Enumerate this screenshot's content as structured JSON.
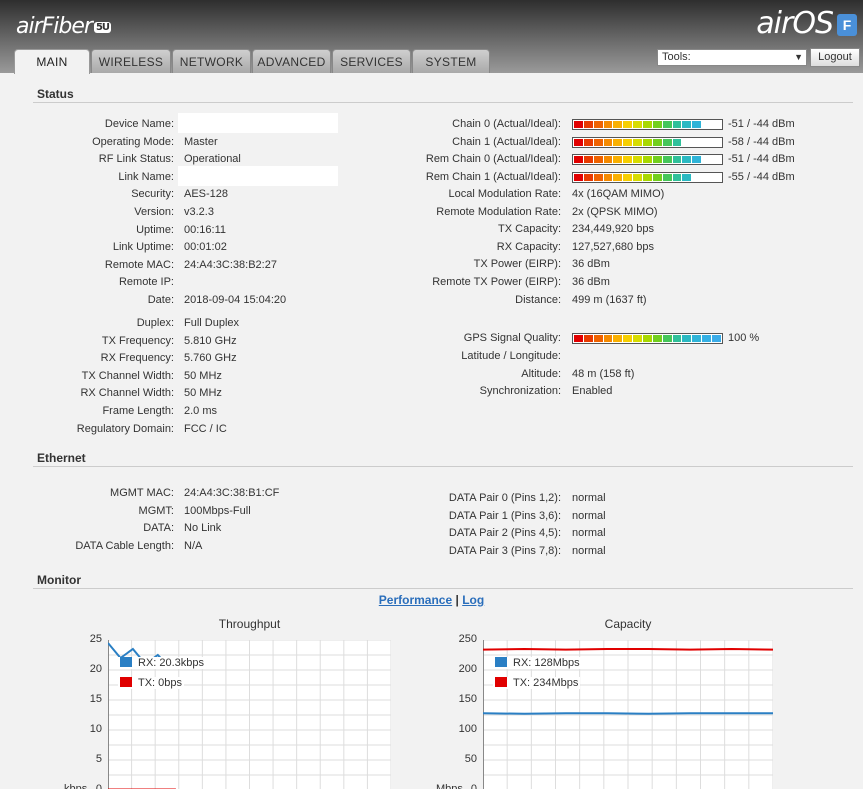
{
  "header": {
    "brand_left": "airFiber",
    "brand_left_sub": "5U",
    "brand_right": "airOS",
    "brand_badge": "F"
  },
  "tabs": [
    {
      "label": "MAIN",
      "active": true
    },
    {
      "label": "WIRELESS"
    },
    {
      "label": "NETWORK"
    },
    {
      "label": "ADVANCED"
    },
    {
      "label": "SERVICES"
    },
    {
      "label": "SYSTEM"
    }
  ],
  "tools": {
    "selected": "Tools:",
    "logout_label": "Logout"
  },
  "status": {
    "title": "Status",
    "left": [
      {
        "label": "Device Name:",
        "value": ""
      },
      {
        "label": "Operating Mode:",
        "value": "Master"
      },
      {
        "label": "RF Link Status:",
        "value": "Operational"
      },
      {
        "label": "Link Name:",
        "value": ""
      },
      {
        "label": "Security:",
        "value": "AES-128"
      },
      {
        "label": "Version:",
        "value": "v3.2.3"
      },
      {
        "label": "Uptime:",
        "value": "00:16:11"
      },
      {
        "label": "Link Uptime:",
        "value": "00:01:02"
      },
      {
        "label": "Remote MAC:",
        "value": "24:A4:3C:38:B2:27"
      },
      {
        "label": "Remote IP:",
        "value": ""
      },
      {
        "label": "Date:",
        "value": "2018-09-04 15:04:20"
      }
    ],
    "left2": [
      {
        "label": "Duplex:",
        "value": "Full Duplex"
      },
      {
        "label": "TX Frequency:",
        "value": "5.810 GHz"
      },
      {
        "label": "RX Frequency:",
        "value": "5.760 GHz"
      },
      {
        "label": "TX Channel Width:",
        "value": "50 MHz"
      },
      {
        "label": "RX Channel Width:",
        "value": "50 MHz"
      },
      {
        "label": "Frame Length:",
        "value": "2.0 ms"
      },
      {
        "label": "Regulatory Domain:",
        "value": "FCC / IC"
      }
    ],
    "chains": [
      {
        "label": "Chain 0 (Actual/Ideal):",
        "value": "-51 / -44 dBm",
        "level": 0.88
      },
      {
        "label": "Chain 1 (Actual/Ideal):",
        "value": "-58 / -44 dBm",
        "level": 0.72
      },
      {
        "label": "Rem Chain 0 (Actual/Ideal):",
        "value": "-51 / -44 dBm",
        "level": 0.88
      },
      {
        "label": "Rem Chain 1 (Actual/Ideal):",
        "value": "-55 / -44 dBm",
        "level": 0.8
      }
    ],
    "right": [
      {
        "label": "Local Modulation Rate:",
        "value": "4x (16QAM MIMO)"
      },
      {
        "label": "Remote Modulation Rate:",
        "value": "2x (QPSK MIMO)"
      },
      {
        "label": "TX Capacity:",
        "value": "234,449,920 bps"
      },
      {
        "label": "RX Capacity:",
        "value": "127,527,680 bps"
      },
      {
        "label": "TX Power (EIRP):",
        "value": "36 dBm"
      },
      {
        "label": "Remote TX Power (EIRP):",
        "value": "36 dBm"
      },
      {
        "label": "Distance:",
        "value": "499 m (1637 ft)"
      }
    ],
    "gps": {
      "label": "GPS Signal Quality:",
      "value": "100 %",
      "level": 1.0
    },
    "right2": [
      {
        "label": "Latitude / Longitude:",
        "value": ""
      },
      {
        "label": "Altitude:",
        "value": "48 m (158 ft)"
      },
      {
        "label": "Synchronization:",
        "value": "Enabled"
      }
    ]
  },
  "ethernet": {
    "title": "Ethernet",
    "left": [
      {
        "label": "MGMT MAC:",
        "value": "24:A4:3C:38:B1:CF"
      },
      {
        "label": "MGMT:",
        "value": "100Mbps-Full"
      },
      {
        "label": "DATA:",
        "value": "No Link"
      },
      {
        "label": "DATA Cable Length:",
        "value": "N/A"
      }
    ],
    "right": [
      {
        "label": "DATA Pair 0 (Pins 1,2):",
        "value": "normal"
      },
      {
        "label": "DATA Pair 1 (Pins 3,6):",
        "value": "normal"
      },
      {
        "label": "DATA Pair 2 (Pins 4,5):",
        "value": "normal"
      },
      {
        "label": "DATA Pair 3 (Pins 7,8):",
        "value": "normal"
      }
    ]
  },
  "monitor": {
    "title": "Monitor",
    "link_performance": "Performance",
    "link_sep": "|",
    "link_log": "Log"
  },
  "chart_data": [
    {
      "type": "line",
      "title": "Throughput",
      "ylabel": "kbps",
      "ylim": [
        0,
        25
      ],
      "yticks": [
        0,
        5,
        10,
        15,
        20,
        25
      ],
      "series": [
        {
          "name": "RX: 20.3kbps",
          "color": "#2a7fc4",
          "values": [
            24.5,
            22,
            23.5,
            21,
            22.5,
            20.3
          ]
        },
        {
          "name": "TX: 0bps",
          "color": "#e00000",
          "values": [
            0,
            0,
            0,
            0,
            0,
            0
          ]
        }
      ]
    },
    {
      "type": "line",
      "title": "Capacity",
      "ylabel": "Mbps",
      "ylim": [
        0,
        250
      ],
      "yticks": [
        0,
        50,
        100,
        150,
        200,
        250
      ],
      "series": [
        {
          "name": "RX: 128Mbps",
          "color": "#2a7fc4",
          "values": [
            128,
            127,
            128,
            128,
            127,
            128,
            128,
            128
          ]
        },
        {
          "name": "TX: 234Mbps",
          "color": "#e00000",
          "values": [
            234,
            235,
            234,
            235,
            235,
            234,
            235,
            234
          ]
        }
      ]
    }
  ]
}
